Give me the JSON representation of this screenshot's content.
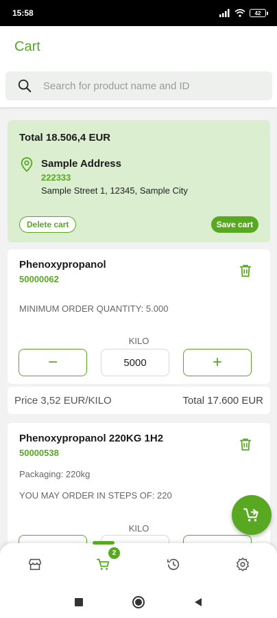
{
  "status_bar": {
    "time": "15:58",
    "battery": "42"
  },
  "header": {
    "title": "Cart",
    "search": {
      "placeholder": "Search for product name and ID",
      "value": ""
    }
  },
  "summary": {
    "total": "Total 18.506,4 EUR",
    "address": {
      "name": "Sample Address",
      "id": "222333",
      "street": "Sample Street 1, 12345, Sample City"
    },
    "delete_label": "Delete cart",
    "save_label": "Save cart"
  },
  "products": [
    {
      "name": "Phenoxypropanol",
      "id": "50000062",
      "note": "MINIMUM ORDER QUANTITY: 5.000",
      "unit": "KILO",
      "quantity": "5000",
      "minus": "−",
      "plus": "+",
      "price": "Price 3,52 EUR/KILO",
      "total": "Total 17.600 EUR"
    },
    {
      "name": "Phenoxypropanol 220KG 1H2",
      "id": "50000538",
      "packaging": "Packaging: 220kg",
      "note": "YOU MAY ORDER IN STEPS OF: 220",
      "unit": "KILO"
    }
  ],
  "bottom_nav": {
    "items": [
      {
        "icon": "store-icon"
      },
      {
        "icon": "cart-icon",
        "badge": "2",
        "active": true
      },
      {
        "icon": "history-icon"
      },
      {
        "icon": "gear-icon"
      }
    ]
  },
  "colors": {
    "accent": "#58a822",
    "summary_bg": "#dceed0"
  }
}
